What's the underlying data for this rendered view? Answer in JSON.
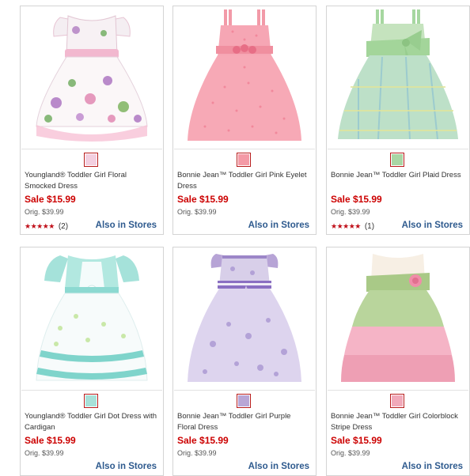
{
  "products": [
    {
      "name": "Youngland® Toddler Girl Floral Smocked Dress",
      "sale": "Sale $15.99",
      "orig": "Orig. $39.99",
      "rating_stars": "★★★★★",
      "rating_value": 4.5,
      "rating_count": "(2)",
      "also": "Also in Stores",
      "swatch_color": "#f3cfe0",
      "dress_icon": "floral-dress-icon"
    },
    {
      "name": "Bonnie Jean™ Toddler Girl Pink Eyelet Dress",
      "sale": "Sale $15.99",
      "orig": "Orig. $39.99",
      "rating_stars": "",
      "rating_count": "",
      "also": "Also in Stores",
      "swatch_color": "#f49aa6",
      "dress_icon": "pink-eyelet-dress-icon"
    },
    {
      "name": "Bonnie Jean™ Toddler Girl Plaid Dress",
      "sale": "Sale $15.99",
      "orig": "Orig. $39.99",
      "rating_stars": "★★★★★",
      "rating_value": 5,
      "rating_count": "(1)",
      "also": "Also in Stores",
      "swatch_color": "#a9d6a4",
      "dress_icon": "plaid-dress-icon"
    },
    {
      "name": "Youngland® Toddler Girl Dot Dress with Cardigan",
      "sale": "Sale $15.99",
      "orig": "Orig. $39.99",
      "rating_stars": "",
      "rating_count": "",
      "also": "Also in Stores",
      "swatch_color": "#a7e0d8",
      "dress_icon": "dot-dress-cardigan-icon"
    },
    {
      "name": "Bonnie Jean™ Toddler Girl Purple Floral Dress",
      "sale": "Sale $15.99",
      "orig": "Orig. $39.99",
      "rating_stars": "",
      "rating_count": "",
      "also": "Also in Stores",
      "swatch_color": "#b8a6d6",
      "dress_icon": "purple-floral-dress-icon"
    },
    {
      "name": "Bonnie Jean™ Toddler Girl Colorblock Stripe Dress",
      "sale": "Sale $15.99",
      "orig": "Orig. $39.99",
      "rating_stars": "",
      "rating_count": "",
      "also": "Also in Stores",
      "swatch_color": "#f1a9b9",
      "dress_icon": "colorblock-dress-icon"
    }
  ],
  "colors": {
    "sale": "#cc0000",
    "link": "#2e5a8e",
    "border": "#d4d4d4",
    "star": "#c0101a"
  }
}
